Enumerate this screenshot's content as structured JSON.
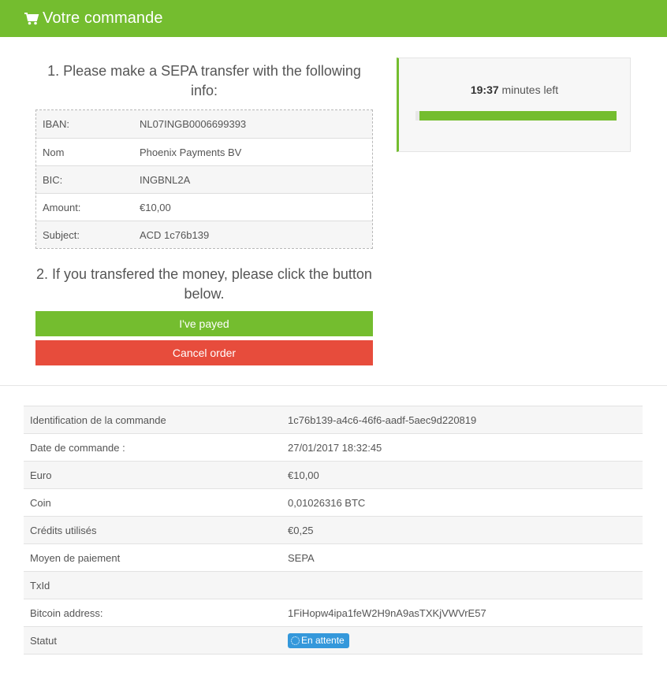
{
  "header": {
    "title": "Votre commande",
    "icon": "cart-icon"
  },
  "payment": {
    "step1_title": "1. Please make a SEPA transfer with the following info:",
    "rows": [
      {
        "label": "IBAN:",
        "value": "NL07INGB0006699393"
      },
      {
        "label": "Nom",
        "value": "Phoenix Payments BV"
      },
      {
        "label": "BIC:",
        "value": "INGBNL2A"
      },
      {
        "label": "Amount:",
        "value": "€10,00"
      },
      {
        "label": "Subject:",
        "value": "ACD 1c76b139"
      }
    ],
    "step2_title": "2. If you transfered the money, please click the button below.",
    "paid_button": "I've payed",
    "cancel_button": "Cancel order"
  },
  "timer": {
    "time": "19:37",
    "suffix": "minutes left",
    "progress_fraction": 0.98
  },
  "order": {
    "rows": [
      {
        "label": "Identification de la commande",
        "value": "1c76b139-a4c6-46f6-aadf-5aec9d220819"
      },
      {
        "label": "Date de commande :",
        "value": "27/01/2017 18:32:45"
      },
      {
        "label": "Euro",
        "value": "€10,00"
      },
      {
        "label": "Coin",
        "value": "0,01026316 BTC"
      },
      {
        "label": "Crédits utilisés",
        "value": "€0,25"
      },
      {
        "label": "Moyen de paiement",
        "value": "SEPA"
      },
      {
        "label": "TxId",
        "value": ""
      },
      {
        "label": "Bitcoin address:",
        "value": "1FiHopw4ipa1feW2H9nA9asTXKjVWVrE57"
      }
    ],
    "status_label": "Statut",
    "status_badge": "En attente"
  },
  "colors": {
    "primary": "#74bd2f",
    "danger": "#e74c3c",
    "badge": "#3498db"
  }
}
